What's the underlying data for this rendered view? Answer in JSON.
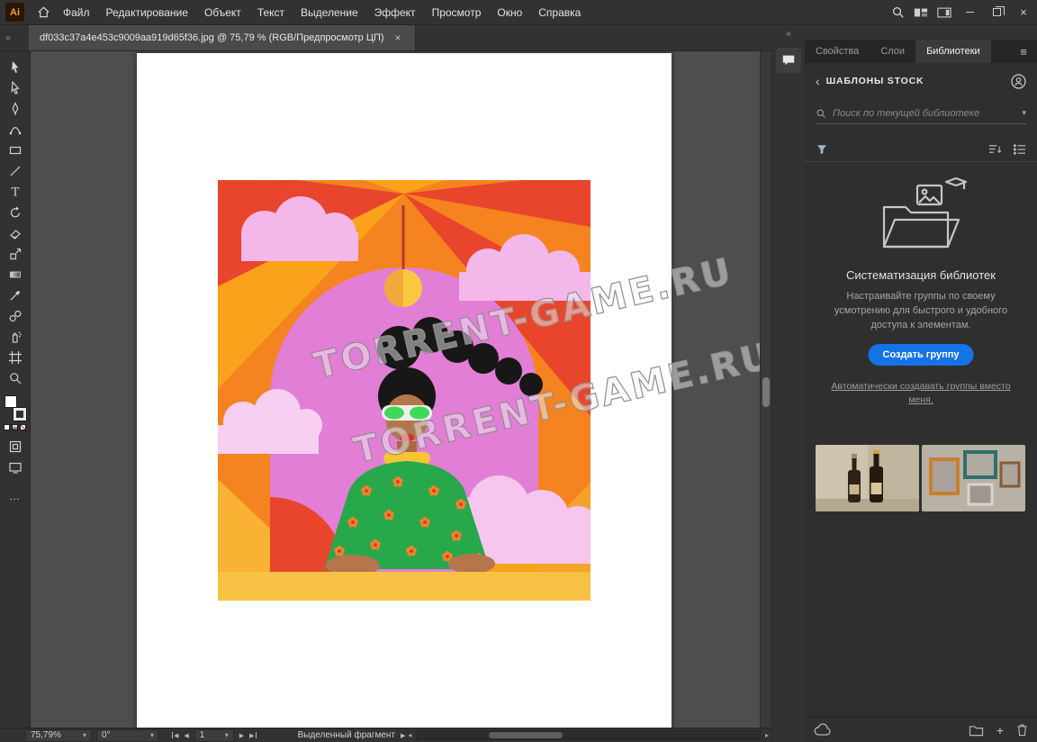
{
  "branding": {
    "app_logo": "Ai"
  },
  "menu_bar": {
    "items": [
      "Файл",
      "Редактирование",
      "Объект",
      "Текст",
      "Выделение",
      "Эффект",
      "Просмотр",
      "Окно",
      "Справка"
    ]
  },
  "document_tab": {
    "title": "df033c37a4e453c9009aa919d65f36.jpg @ 75,79 % (RGB/Предпросмотр ЦП)"
  },
  "toolbar": {
    "tools": [
      "selection",
      "direct-selection",
      "pen",
      "curvature",
      "rectangle",
      "line-segment",
      "type",
      "rotate",
      "eraser",
      "scale",
      "gradient",
      "eyedropper",
      "blend",
      "symbol-sprayer",
      "artboard",
      "zoom"
    ]
  },
  "canvas": {
    "watermark": "TORRENT-GAME.RU"
  },
  "right_panel": {
    "tabs": [
      "Свойства",
      "Слои",
      "Библиотеки"
    ],
    "active_tab_index": 2,
    "library": {
      "header": "ШАБЛОНЫ STOCK",
      "search_placeholder": "Поиск по текущей библиотеке",
      "empty_state": {
        "title": "Систематизация библиотек",
        "description": "Настраивайте группы по своему усмотрению для быстрого и удобного доступа к элементам.",
        "button": "Создать группу",
        "link": "Автоматически создавать группы вместо меня."
      },
      "items": [
        "bottles-photo",
        "frames-photo"
      ]
    }
  },
  "status_bar": {
    "zoom": "75,79%",
    "rotation": "0°",
    "artboard_number": "1",
    "status": "Выделенный фрагмент"
  },
  "colors": {
    "accent_blue": "#1473E6",
    "pasteboard": "#4e4e4e"
  },
  "icons": {
    "close": "×",
    "chevron_down": "▾",
    "chevrons_left": "«",
    "chevrons_right": "»",
    "back": "‹",
    "hamburger": "≡",
    "more": "…",
    "plus": "+",
    "nav_prev": "◀",
    "nav_next": "▶",
    "popup_arrow": "▶",
    "scroll_left": "◂",
    "scroll_right": "▸"
  }
}
